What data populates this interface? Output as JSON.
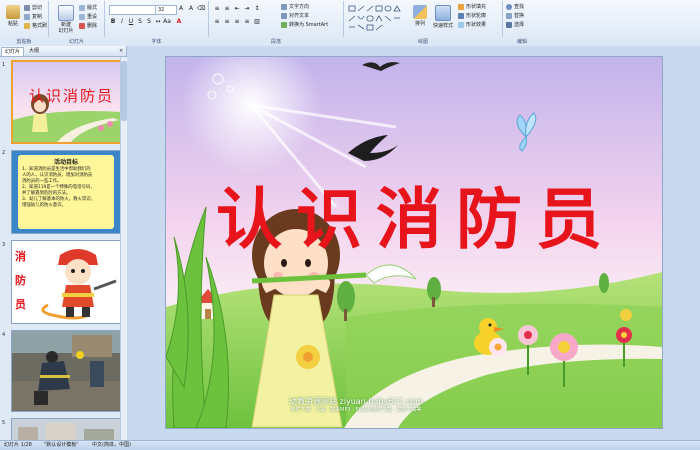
{
  "ribbon": {
    "groups": {
      "clipboard": "剪贴板",
      "slides": "幻灯片",
      "font": "字体",
      "paragraph": "段落",
      "drawing": "绘图",
      "editing": "编辑"
    },
    "paste": "粘贴",
    "cut": "剪切",
    "copy": "复制",
    "format_painter": "格式刷",
    "new_slide": "新建\n幻灯片",
    "layout": "版式",
    "reset": "重设",
    "delete": "删除",
    "font_size": "32",
    "text_direction": "文字方向",
    "align_text": "对齐文本",
    "convert_smartart": "转换为 SmartArt",
    "arrange": "排列",
    "quick_styles": "快速样式",
    "shape_fill": "形状填充",
    "shape_outline": "形状轮廓",
    "shape_effects": "形状效果",
    "find": "查找",
    "replace": "替换",
    "select": "选择"
  },
  "panel": {
    "tab_slides": "幻灯片",
    "tab_outline": "大纲",
    "close": "×"
  },
  "thumbs": [
    {
      "num": "1",
      "title": "认识消防员"
    },
    {
      "num": "2",
      "title": "活动目标",
      "lines": [
        "1、知道消防员是生活中帮助我们的",
        "人的人，认识消防员，增加对消防员",
        "消防员的一些工作。",
        "2、知道119是一个特殊的电话号码，",
        "并了解遇到危险的方法。",
        "3、幼儿了解基本的防火，救火常识，",
        "增强幼儿的防火意识。"
      ]
    },
    {
      "num": "3",
      "title": "消防员"
    },
    {
      "num": "4"
    },
    {
      "num": "5"
    }
  ],
  "slide": {
    "title_chars": [
      "认",
      "识",
      "消",
      "防",
      "员"
    ],
    "footer_line1": "幼教资源网站 ziyuan.baby611.com",
    "footer_line2": "课件下载 · 儿歌 · 故事MP3 · FLASH课件下载 · 试卷下载等"
  },
  "status": {
    "slide_count": "幻灯片 1/28",
    "theme": "\"默认设计模板\"",
    "language": "中文(简体，中国)"
  },
  "colors": {
    "title_red": "#e8141c",
    "ribbon_bg": "#dbe7f6",
    "workspace_bg": "#c9d9ee"
  }
}
